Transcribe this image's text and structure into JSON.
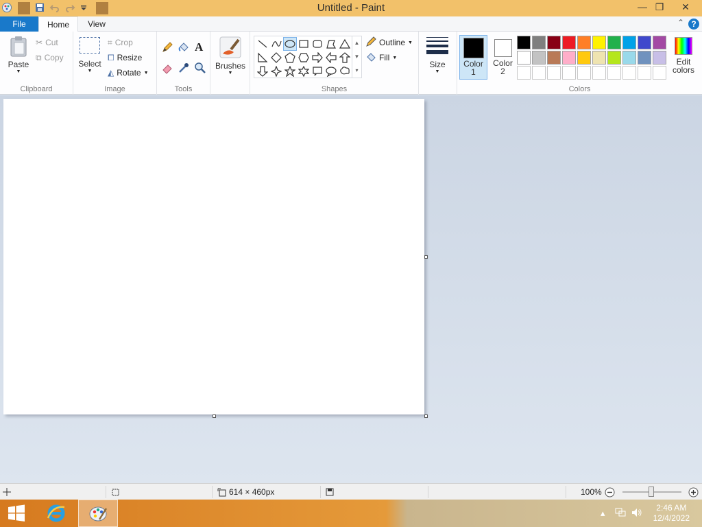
{
  "window": {
    "title": "Untitled - Paint",
    "minimize": "—",
    "restore": "❐",
    "close": "✕"
  },
  "tabs": {
    "file": "File",
    "home": "Home",
    "view": "View",
    "help": "?"
  },
  "clipboard": {
    "paste": "Paste",
    "cut": "Cut",
    "copy": "Copy",
    "group": "Clipboard"
  },
  "image": {
    "select": "Select",
    "crop": "Crop",
    "resize": "Resize",
    "rotate": "Rotate",
    "group": "Image"
  },
  "tools": {
    "group": "Tools",
    "text_glyph": "A"
  },
  "brushes": {
    "label": "Brushes"
  },
  "shapes": {
    "outline": "Outline",
    "fill": "Fill",
    "group": "Shapes"
  },
  "size": {
    "label": "Size"
  },
  "colors": {
    "color1_label": "Color",
    "color1_num": "1",
    "color2_label": "Color",
    "color2_num": "2",
    "edit_label_1": "Edit",
    "edit_label_2": "colors",
    "group": "Colors",
    "color1": "#000000",
    "color2": "#ffffff",
    "palette_row1": [
      "#000000",
      "#7f7f7f",
      "#880015",
      "#ed1c24",
      "#ff7f27",
      "#fff200",
      "#22b14c",
      "#00a2e8",
      "#3f48cc",
      "#a349a4"
    ],
    "palette_row2": [
      "#ffffff",
      "#c3c3c3",
      "#b97a57",
      "#ffaec9",
      "#ffc90e",
      "#efe4b0",
      "#b5e61d",
      "#99d9ea",
      "#7092be",
      "#c8bfe7"
    ]
  },
  "status": {
    "dimensions": "614 × 460px",
    "zoom": "100%"
  },
  "taskbar": {
    "time": "2:46 AM",
    "date": "12/4/2022"
  }
}
